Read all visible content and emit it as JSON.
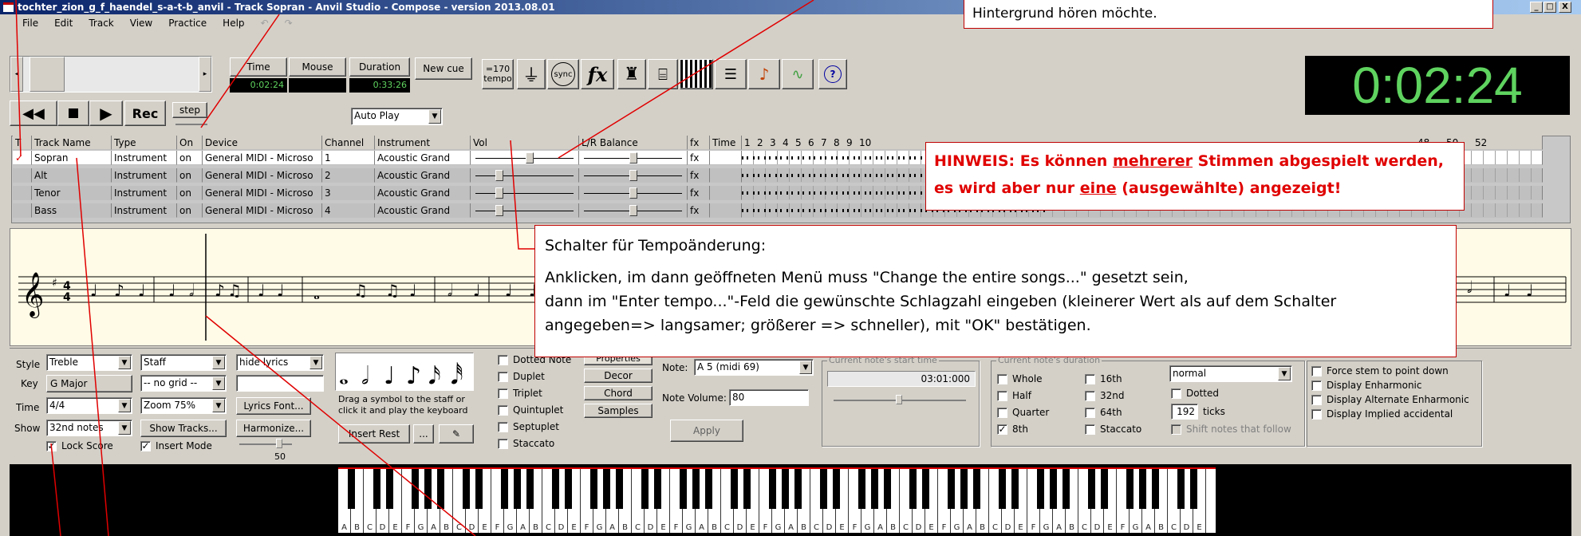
{
  "title": "tochter_zion_g_f_haendel_s-a-t-b_anvil - Track Sopran - Anvil Studio - Compose - version 2013.08.01",
  "window_buttons": [
    "_",
    "□",
    "X"
  ],
  "menu": [
    "File",
    "Edit",
    "Track",
    "View",
    "Practice",
    "Help"
  ],
  "transport": {
    "time_label": "Time",
    "time_value": "0:02:24",
    "mouse_label": "Mouse",
    "duration_label": "Duration",
    "duration_value": "0:33:26",
    "new_cue": "New cue",
    "tempo_line1": "=170",
    "tempo_line2": "tempo",
    "rec": "Rec",
    "step": "step",
    "autoplay": "Auto Play",
    "sync_label": "sync",
    "fx_label": "fx",
    "help_label": "?"
  },
  "big_clock": "0:02:24",
  "track_table": {
    "headers": [
      "T",
      "Track Name",
      "Type",
      "On",
      "Device",
      "Channel",
      "Instrument",
      "Vol",
      "L/R Balance",
      "fx",
      "Time"
    ],
    "time_ticks": [
      "1",
      "2",
      "3",
      "4",
      "5",
      "6",
      "7",
      "8",
      "9",
      "10",
      "48",
      "50",
      "52"
    ],
    "rows": [
      {
        "name": "Sopran",
        "type": "Instrument",
        "on": "on",
        "device": "General MIDI - Microso",
        "channel": "1",
        "instrument": "Acoustic Grand",
        "fx": "fx",
        "vol": 0.55,
        "bal": 0.5
      },
      {
        "name": "Alt",
        "type": "Instrument",
        "on": "on",
        "device": "General MIDI - Microso",
        "channel": "2",
        "instrument": "Acoustic Grand",
        "fx": "fx",
        "vol": 0.22,
        "bal": 0.5
      },
      {
        "name": "Tenor",
        "type": "Instrument",
        "on": "on",
        "device": "General MIDI - Microso",
        "channel": "3",
        "instrument": "Acoustic Grand",
        "fx": "fx",
        "vol": 0.22,
        "bal": 0.5
      },
      {
        "name": "Bass",
        "type": "Instrument",
        "on": "on",
        "device": "General MIDI - Microso",
        "channel": "4",
        "instrument": "Acoustic Grand",
        "fx": "fx",
        "vol": 0.22,
        "bal": 0.5
      }
    ]
  },
  "callouts": {
    "top_note": "Hintergrund hören möchte.",
    "hinweis_1a": "HINWEIS: Es können ",
    "hinweis_1b": "mehrerer",
    "hinweis_1c": " Stimmen abgespielt werden,",
    "hinweis_2a": "es wird aber nur ",
    "hinweis_2b": "eine",
    "hinweis_2c": " (ausgewählte) angezeigt!",
    "tempo_title": "Schalter für Tempoänderung:",
    "tempo_line1": "Anklicken, im dann geöffneten Menü muss \"Change the entire songs...\" gesetzt sein,",
    "tempo_line2": "dann im \"Enter tempo...\"-Feld die gewünschte Schlagzahl eingeben (kleinerer Wert als auf dem Schalter",
    "tempo_line3": "angegeben=> langsamer; größerer => schneller), mit \"OK\" bestätigen."
  },
  "controls": {
    "style_label": "Style",
    "style_value": "Treble",
    "staff_value": "Staff",
    "hidelyrics_value": "hide lyrics",
    "key_label": "Key",
    "key_value": "G Major",
    "grid_value": "-- no grid --",
    "time_label": "Time",
    "time_value": "4/4",
    "zoom_value": "Zoom 75%",
    "lyrics_font": "Lyrics Font...",
    "show_label": "Show",
    "show_value": "32nd notes",
    "show_tracks": "Show Tracks...",
    "harmonize": "Harmonize...",
    "lock_score": "Lock Score",
    "insert_mode": "Insert Mode",
    "slider_value": "50",
    "drag_hint1": "Drag a symbol to the staff or",
    "drag_hint2": "click it and play the keyboard",
    "insert_rest": "Insert Rest",
    "ellipsis": "...",
    "dotted_note": "Dotted Note",
    "duplet": "Duplet",
    "triplet": "Triplet",
    "quintuplet": "Quintuplet",
    "septuplet": "Septuplet",
    "staccato": "Staccato",
    "properties": "Properties",
    "decor": "Decor",
    "chord": "Chord",
    "samples": "Samples",
    "note_label": "Note:",
    "note_value": "A 5 (midi 69)",
    "note_volume_label": "Note Volume:",
    "note_volume_value": "80",
    "apply": "Apply",
    "start_time_title": "Current note's start time",
    "start_time_value": "03:01:000",
    "duration_title": "Current note's duration",
    "whole": "Whole",
    "half": "Half",
    "quarter": "Quarter",
    "eighth": "8th",
    "sixteenth": "16th",
    "thirtysecond": "32nd",
    "sixtyfourth": "64th",
    "staccato2": "Staccato",
    "normal_value": "normal",
    "dotted": "Dotted",
    "ticks_value": "192",
    "ticks_label": "ticks",
    "shift_notes": "Shift notes that follow",
    "force_stem": "Force stem to point down",
    "disp_enh": "Display Enharmonic",
    "disp_alt_enh": "Display Alternate Enharmonic",
    "disp_impl": "Display Implied accidental"
  },
  "keyboard_notes": [
    "A",
    "B",
    "C",
    "D",
    "E",
    "F",
    "G"
  ],
  "colors": {
    "accent_red": "#e00000",
    "clock_green": "#5fd35f",
    "score_bg": "#fffbe6"
  }
}
